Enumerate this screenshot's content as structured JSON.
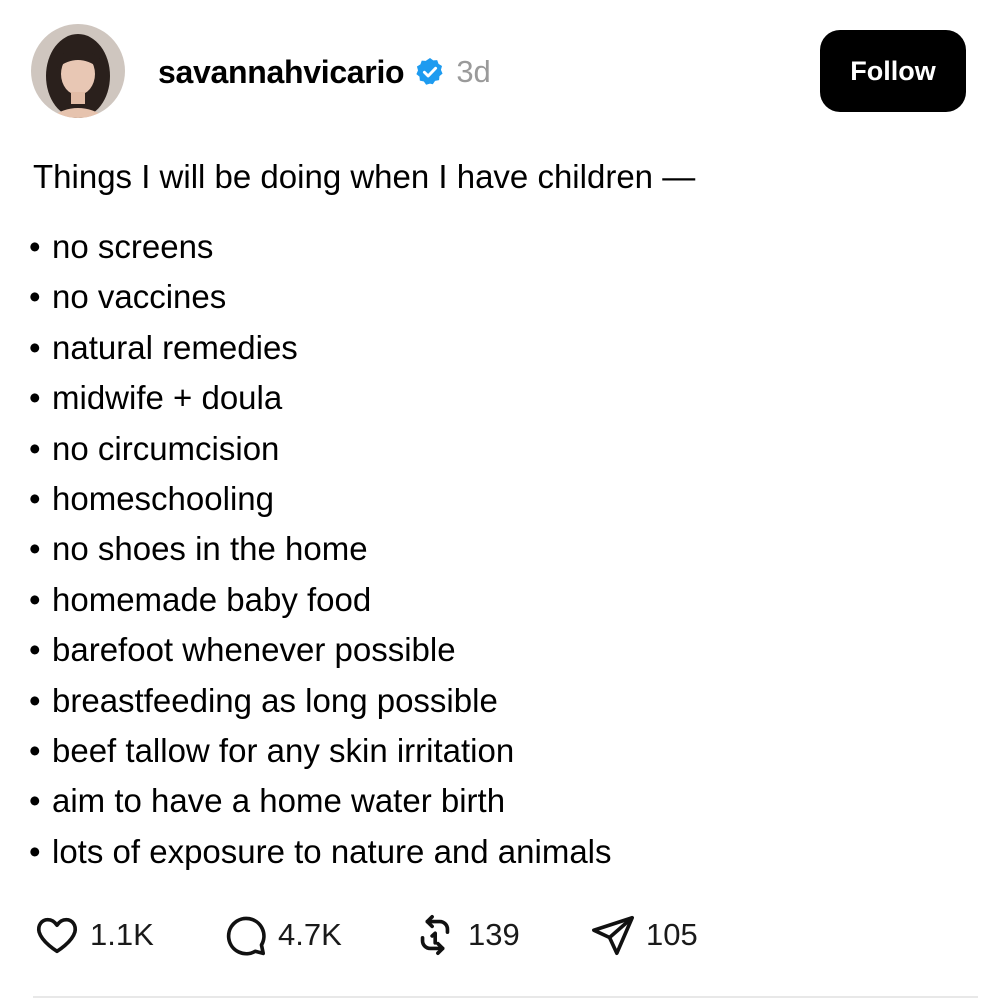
{
  "post": {
    "username": "savannahvicario",
    "timestamp": "3d",
    "follow_label": "Follow",
    "title": "Things I will be doing when I have children —",
    "bullet": "•",
    "items": [
      "no screens",
      "no vaccines",
      "natural remedies",
      "midwife + doula",
      "no circumcision",
      "homeschooling",
      "no shoes in the home",
      "homemade baby food",
      "barefoot whenever possible",
      "breastfeeding as long possible",
      "beef tallow for any skin irritation",
      "aim to have a home water birth",
      "lots of exposure to nature and animals"
    ]
  },
  "actions": {
    "likes": "1.1K",
    "comments": "4.7K",
    "reposts": "139",
    "shares": "105"
  },
  "icons": {
    "verified": "verified-badge-icon",
    "like": "heart-icon",
    "comment": "comment-bubble-icon",
    "repost": "repost-icon",
    "share": "send-icon"
  },
  "colors": {
    "verified": "#1d9bf0",
    "follow_bg": "#000000",
    "timestamp": "#9a9a9a"
  }
}
